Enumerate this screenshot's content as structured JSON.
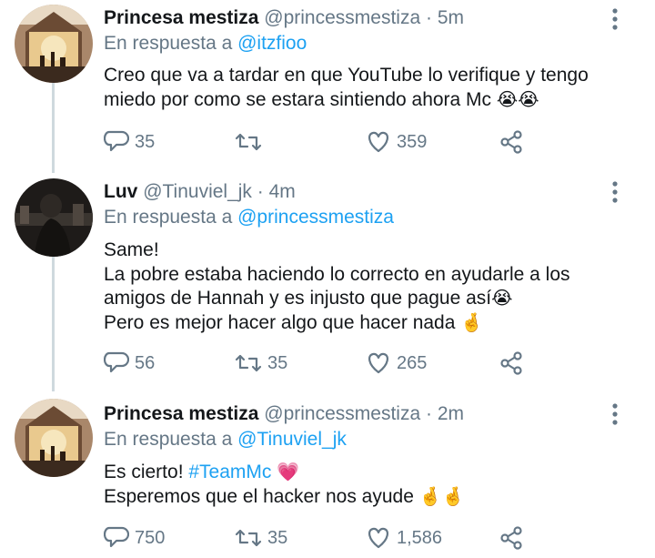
{
  "colors": {
    "link": "#1da1f2",
    "secondary": "#657786",
    "text": "#14171a"
  },
  "tweets": [
    {
      "name": "Princesa mestiza",
      "handle": "@princessmestiza",
      "separator": "·",
      "time": "5m",
      "reply_prefix": "En respuesta a",
      "reply_to": "@itzfioo",
      "lines": [
        "Creo que va a tardar en que YouTube lo verifique y tengo",
        "miedo por como se estara sintiendo ahora Mc"
      ],
      "emoji_end": "😭😭",
      "replies": "35",
      "retweets": "",
      "likes": "359",
      "icons": [
        "reply-icon",
        "retweet-icon",
        "like-icon",
        "share-icon",
        "more-icon"
      ]
    },
    {
      "name": "Luv",
      "handle": "@Tinuviel_jk",
      "separator": "·",
      "time": "4m",
      "reply_prefix": "En respuesta a",
      "reply_to": "@princessmestiza",
      "lines": [
        "Same!",
        "La pobre estaba haciendo lo correcto en ayudarle a los",
        "amigos de Hannah y es injusto que pague así",
        "Pero es mejor hacer algo que hacer nada"
      ],
      "emoji_line3": "😭",
      "emoji_line4": "🤞",
      "replies": "56",
      "retweets": "35",
      "likes": "265"
    },
    {
      "name": "Princesa mestiza",
      "handle": "@princessmestiza",
      "separator": "·",
      "time": "2m",
      "reply_prefix": "En respuesta a",
      "reply_to": "@Tinuviel_jk",
      "line1_prefix": "Es cierto!",
      "hashtag": "#TeamMc",
      "emoji_heart": "💗",
      "line2": "Esperemos que el hacker nos ayude",
      "emoji_end": "🤞🤞",
      "replies": "750",
      "retweets": "35",
      "likes": "1,586"
    }
  ]
}
